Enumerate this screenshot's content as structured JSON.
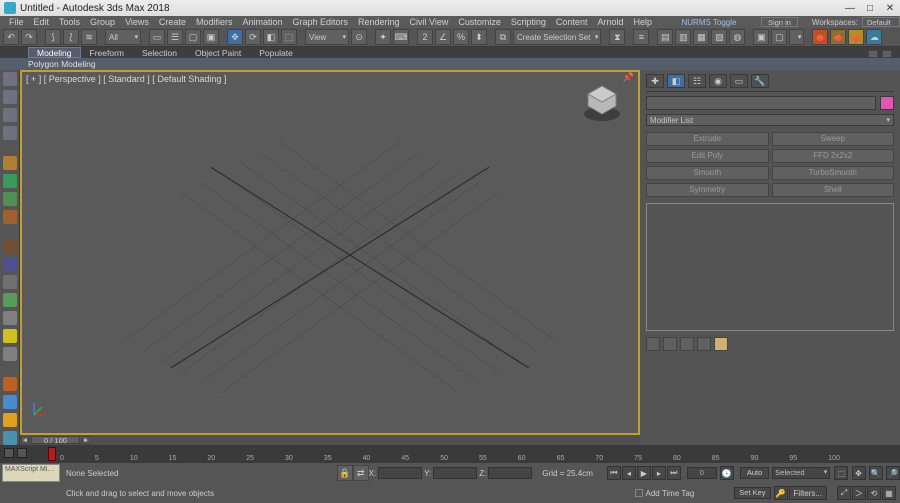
{
  "window": {
    "title": "Untitled - Autodesk 3ds Max 2018",
    "signin": "Sign in",
    "workspaces_label": "Workspaces:",
    "workspaces_value": "Default",
    "nurms": "NURMS Toggle"
  },
  "menu": [
    "File",
    "Edit",
    "Tools",
    "Group",
    "Views",
    "Create",
    "Modifiers",
    "Animation",
    "Graph Editors",
    "Rendering",
    "Civil View",
    "Customize",
    "Scripting",
    "Content",
    "Arnold",
    "Help"
  ],
  "toolbar": {
    "all_drop": "All",
    "view_drop": "View",
    "selset_drop": "Create Selection Set"
  },
  "ribbon": {
    "tabs": [
      "Modeling",
      "Freeform",
      "Selection",
      "Object Paint",
      "Populate"
    ],
    "active": 0,
    "group": "Polygon Modeling"
  },
  "viewport": {
    "label": "[ + ] [ Perspective ] [ Standard ] [ Default Shading ]",
    "timeslider": "0 / 100"
  },
  "cmdpanel": {
    "modifier_list": "Modifier List",
    "btns": [
      "Extrude",
      "Sweep",
      "Edit Poly",
      "FFD 2x2x2",
      "Smooth",
      "TurboSmooth",
      "Symmetry",
      "Shell"
    ]
  },
  "timeline": {
    "ticks": [
      "0",
      "5",
      "10",
      "15",
      "20",
      "25",
      "30",
      "35",
      "40",
      "45",
      "50",
      "55",
      "60",
      "65",
      "70",
      "75",
      "80",
      "85",
      "90",
      "95",
      "100"
    ]
  },
  "status": {
    "selection": "None Selected",
    "prompt": "Click and drag to select and move objects",
    "x_label": "X:",
    "x_val": "",
    "y_label": "Y:",
    "y_val": "",
    "z_label": "Z:",
    "z_val": "",
    "grid": "Grid = 25.4cm",
    "frame": "0",
    "auto": "Auto",
    "setkey": "Set Key",
    "selected_drop": "Selected",
    "filters": "Filters...",
    "add_time_tag": "Add Time Tag",
    "script_hint": "MAXScript Mi…"
  },
  "colors": {
    "accent_yellow": "#c0a030",
    "swatch": "#e255b3"
  }
}
